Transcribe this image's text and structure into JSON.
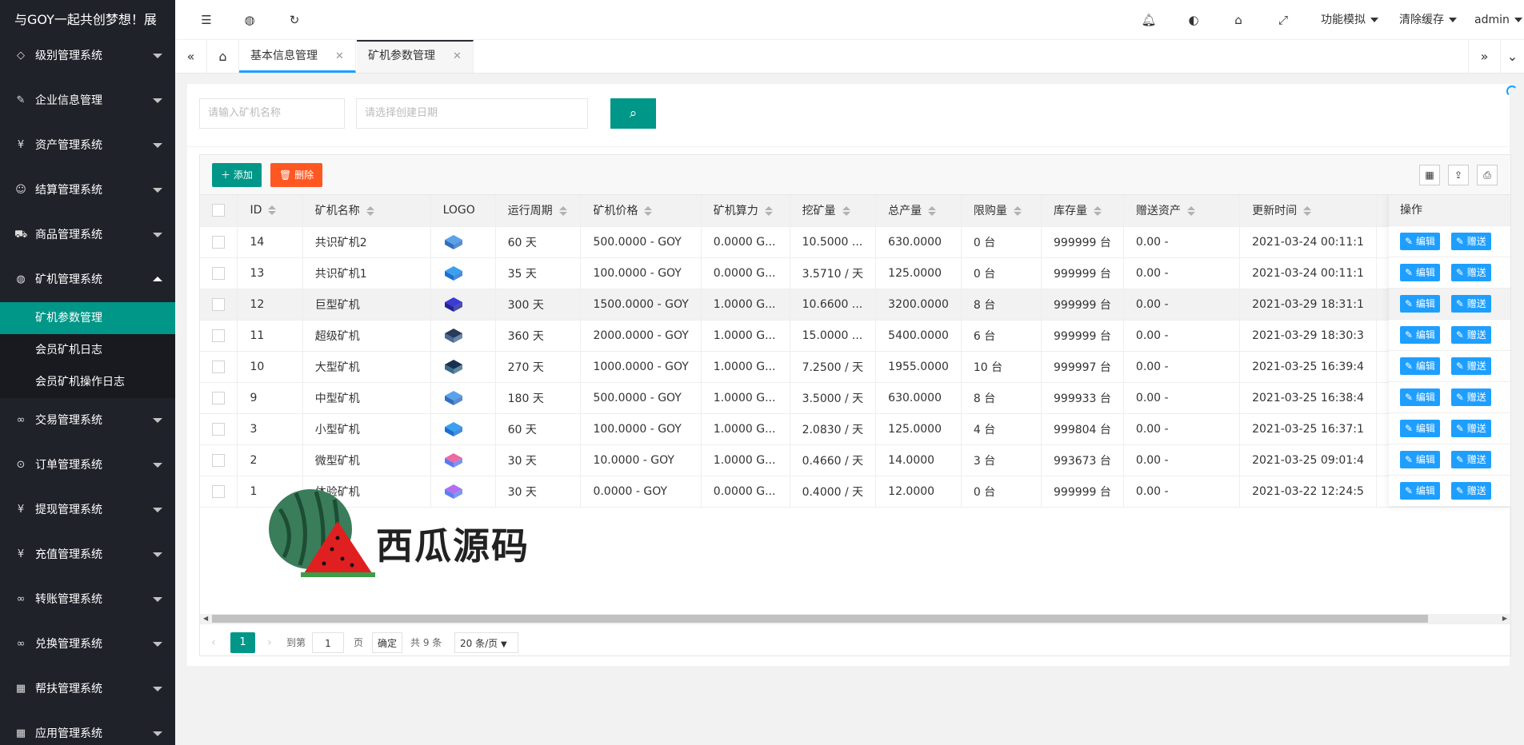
{
  "app": {
    "title": "与GOY一起共创梦想！展"
  },
  "sidebar": {
    "items": [
      {
        "label": "级别管理系统",
        "icon": "diamond-icon"
      },
      {
        "label": "企业信息管理",
        "icon": "edit-doc-icon"
      },
      {
        "label": "资产管理系统",
        "icon": "yen-icon"
      },
      {
        "label": "结算管理系统",
        "icon": "smile-icon"
      },
      {
        "label": "商品管理系统",
        "icon": "cart-icon"
      },
      {
        "label": "矿机管理系统",
        "icon": "globe-icon",
        "expanded": true
      },
      {
        "label": "交易管理系统",
        "icon": "link-icon"
      },
      {
        "label": "订单管理系统",
        "icon": "location-icon"
      },
      {
        "label": "提现管理系统",
        "icon": "yen-icon"
      },
      {
        "label": "充值管理系统",
        "icon": "yen-icon"
      },
      {
        "label": "转账管理系统",
        "icon": "link-icon"
      },
      {
        "label": "兑换管理系统",
        "icon": "link-icon"
      },
      {
        "label": "帮扶管理系统",
        "icon": "apps-icon"
      },
      {
        "label": "应用管理系统",
        "icon": "apps-icon"
      }
    ],
    "subitems": [
      {
        "label": "矿机参数管理",
        "active": true
      },
      {
        "label": "会员矿机日志"
      },
      {
        "label": "会员矿机操作日志"
      }
    ]
  },
  "header": {
    "menus": [
      "功能模拟",
      "清除缓存",
      "admin"
    ]
  },
  "tabs": {
    "items": [
      {
        "label": "基本信息管理"
      },
      {
        "label": "矿机参数管理",
        "active": true
      }
    ]
  },
  "search": {
    "name_placeholder": "请输入矿机名称",
    "date_placeholder": "请选择创建日期"
  },
  "toolbar": {
    "add_label": "添加",
    "delete_label": "删除"
  },
  "table": {
    "columns": [
      "ID",
      "矿机名称",
      "LOGO",
      "运行周期",
      "矿机价格",
      "矿机算力",
      "挖矿量",
      "总产量",
      "限购量",
      "库存量",
      "赠送资产",
      "更新时间",
      "操作"
    ],
    "rows": [
      {
        "id": "14",
        "name": "共识矿机2",
        "cycle": "60 天",
        "price": "500.0000 - GOY",
        "power": "0.0000 G...",
        "mine": "10.5000 ...",
        "total": "630.0000",
        "limit": "0 台",
        "stock": "999999 台",
        "gift": "0.00 -",
        "time": "2021-03-24 00:11:1"
      },
      {
        "id": "13",
        "name": "共识矿机1",
        "cycle": "35 天",
        "price": "100.0000 - GOY",
        "power": "0.0000 G...",
        "mine": "3.5710 / 天",
        "total": "125.0000",
        "limit": "0 台",
        "stock": "999999 台",
        "gift": "0.00 -",
        "time": "2021-03-24 00:11:1"
      },
      {
        "id": "12",
        "name": "巨型矿机",
        "cycle": "300 天",
        "price": "1500.0000 - GOY",
        "power": "1.0000 G...",
        "mine": "10.6600 ...",
        "total": "3200.0000",
        "limit": "8 台",
        "stock": "999999 台",
        "gift": "0.00 -",
        "time": "2021-03-29 18:31:1"
      },
      {
        "id": "11",
        "name": "超级矿机",
        "cycle": "360 天",
        "price": "2000.0000 - GOY",
        "power": "1.0000 G...",
        "mine": "15.0000 ...",
        "total": "5400.0000",
        "limit": "6 台",
        "stock": "999999 台",
        "gift": "0.00 -",
        "time": "2021-03-29 18:30:3"
      },
      {
        "id": "10",
        "name": "大型矿机",
        "cycle": "270 天",
        "price": "1000.0000 - GOY",
        "power": "1.0000 G...",
        "mine": "7.2500 / 天",
        "total": "1955.0000",
        "limit": "10 台",
        "stock": "999997 台",
        "gift": "0.00 -",
        "time": "2021-03-25 16:39:4"
      },
      {
        "id": "9",
        "name": "中型矿机",
        "cycle": "180 天",
        "price": "500.0000 - GOY",
        "power": "1.0000 G...",
        "mine": "3.5000 / 天",
        "total": "630.0000",
        "limit": "8 台",
        "stock": "999933 台",
        "gift": "0.00 -",
        "time": "2021-03-25 16:38:4"
      },
      {
        "id": "3",
        "name": "小型矿机",
        "cycle": "60 天",
        "price": "100.0000 - GOY",
        "power": "1.0000 G...",
        "mine": "2.0830 / 天",
        "total": "125.0000",
        "limit": "4 台",
        "stock": "999804 台",
        "gift": "0.00 -",
        "time": "2021-03-25 16:37:1"
      },
      {
        "id": "2",
        "name": "微型矿机",
        "cycle": "30 天",
        "price": "10.0000 - GOY",
        "power": "1.0000 G...",
        "mine": "0.4660 / 天",
        "total": "14.0000",
        "limit": "3 台",
        "stock": "993673 台",
        "gift": "0.00 -",
        "time": "2021-03-25 09:01:4"
      },
      {
        "id": "1",
        "name": "体验矿机",
        "cycle": "30 天",
        "price": "0.0000 - GOY",
        "power": "0.0000 G...",
        "mine": "0.4000 / 天",
        "total": "12.0000",
        "limit": "0 台",
        "stock": "999999 台",
        "gift": "0.00 -",
        "time": "2021-03-22 12:24:5"
      }
    ],
    "edit_label": "编辑",
    "gift_label": "赠送"
  },
  "pager": {
    "current": "1",
    "goto_label": "到第",
    "goto_value": "1",
    "page_unit": "页",
    "confirm_label": "确定",
    "total_label": "共 9 条",
    "page_size": "20 条/页"
  },
  "watermark": {
    "text": "西瓜源码"
  },
  "colors": {
    "sidebar_bg": "#20222a",
    "accent": "#009688",
    "danger": "#ff5722",
    "blue": "#1e9fff"
  }
}
